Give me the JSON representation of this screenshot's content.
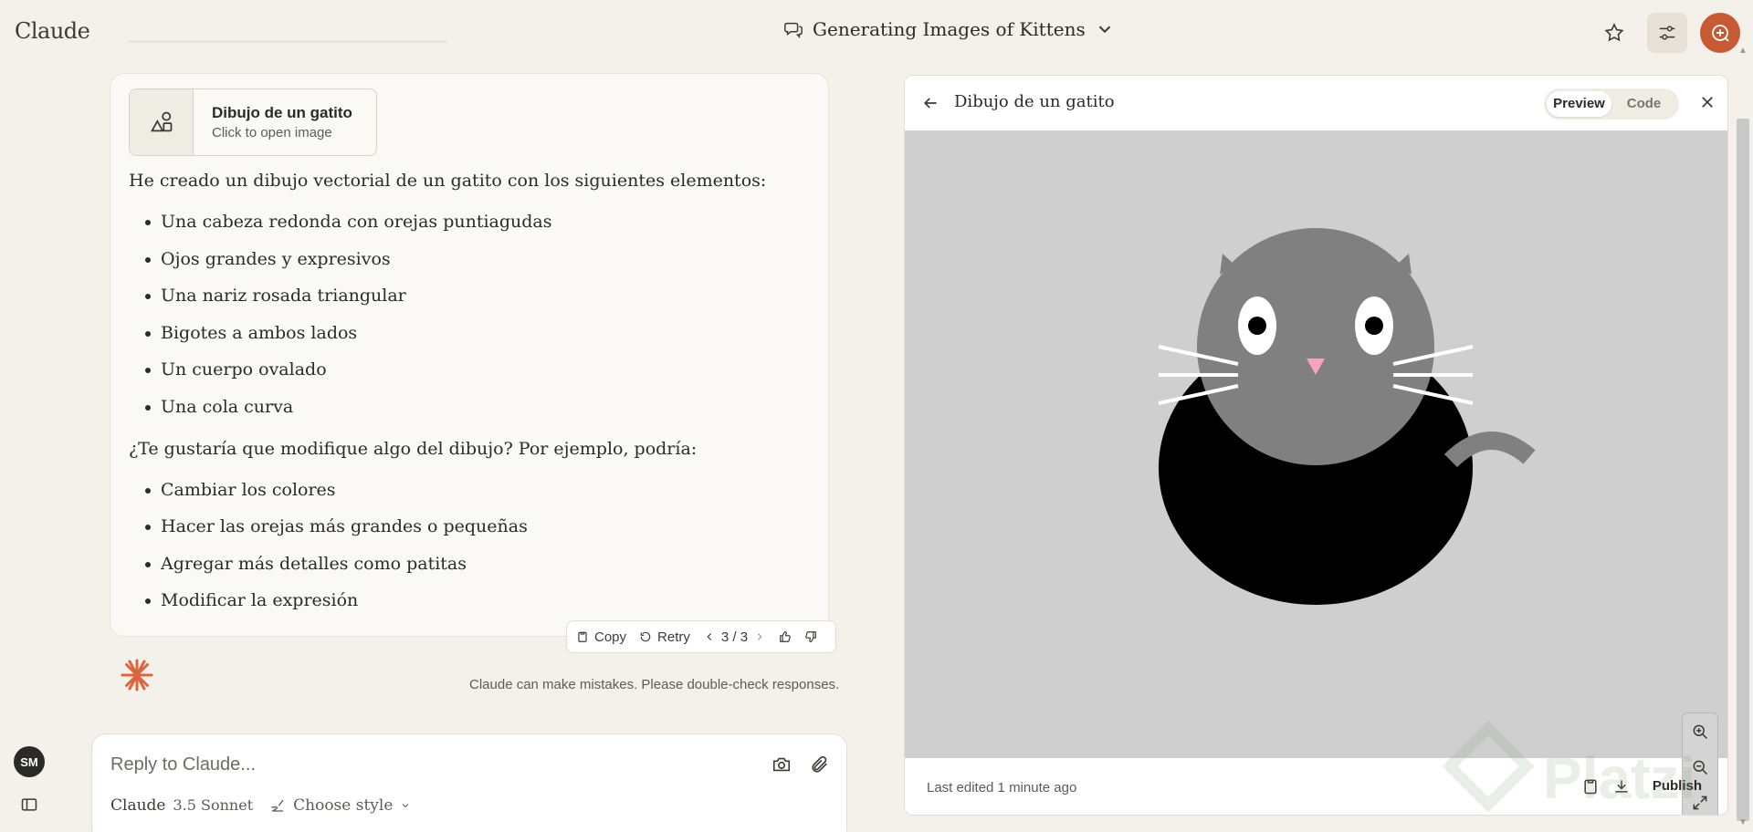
{
  "app": {
    "name": "Claude"
  },
  "header": {
    "title": "Generating Images of Kittens"
  },
  "artifact_chip": {
    "title": "Dibujo de un gatito",
    "subtitle": "Click to open image"
  },
  "message": {
    "intro": "He creado un dibujo vectorial de un gatito con los siguientes elementos:",
    "elements": [
      "Una cabeza redonda con orejas puntiagudas",
      "Ojos grandes y expresivos",
      "Una nariz rosada triangular",
      "Bigotes a ambos lados",
      "Un cuerpo ovalado",
      "Una cola curva"
    ],
    "question": "¿Te gustaría que modifique algo del dibujo? Por ejemplo, podría:",
    "suggestions": [
      "Cambiar los colores",
      "Hacer las orejas más grandes o pequeñas",
      "Agregar más detalles como patitas",
      "Modificar la expresión"
    ]
  },
  "actions": {
    "copy": "Copy",
    "retry": "Retry",
    "pager": "3 / 3"
  },
  "disclaimer": "Claude can make mistakes. Please double-check responses.",
  "user": {
    "initials": "SM"
  },
  "composer": {
    "placeholder": "Reply to Claude...",
    "model_name": "Claude",
    "model_version": "3.5 Sonnet",
    "style_label": "Choose style"
  },
  "artifact_panel": {
    "title": "Dibujo de un gatito",
    "view_preview": "Preview",
    "view_code": "Code",
    "last_edited": "Last edited 1 minute ago",
    "publish": "Publish"
  },
  "watermark": {
    "text": "Platzi"
  },
  "colors": {
    "accent": "#c65a34",
    "kitten_head": "#808080",
    "kitten_body": "#000000",
    "nose": "#f4a6b8",
    "canvas_bg": "#cfcfcf"
  }
}
